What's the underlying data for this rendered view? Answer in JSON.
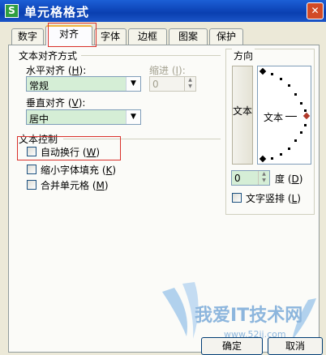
{
  "window": {
    "title": "单元格格式",
    "app_icon": "S"
  },
  "tabs": [
    {
      "label": "数字"
    },
    {
      "label": "对齐",
      "active": true
    },
    {
      "label": "字体"
    },
    {
      "label": "边框"
    },
    {
      "label": "图案"
    },
    {
      "label": "保护"
    }
  ],
  "alignment": {
    "section_title": "文本对齐方式",
    "horizontal_label": "水平对齐 (",
    "horizontal_key": "H",
    "horizontal_value": "常规",
    "indent_label": "缩进 (",
    "indent_key": "I",
    "indent_value": "0",
    "vertical_label": "垂直对齐 (",
    "vertical_key": "V",
    "vertical_value": "居中"
  },
  "text_control": {
    "section_title": "文本控制",
    "wrap_text": {
      "label": "自动换行 (",
      "key": "W",
      "checked": false
    },
    "shrink_to_fit": {
      "label": "缩小字体填充 (",
      "key": "K",
      "checked": false
    },
    "merge_cells": {
      "label": "合并单元格 (",
      "key": "M",
      "checked": false
    }
  },
  "orientation": {
    "section_title": "方向",
    "vertical_text_button": "文本",
    "dial_label": "文本",
    "degree_value": "0",
    "degree_label": "度 (",
    "degree_key": "D",
    "vertical_stack": {
      "label": "文字竖排 (",
      "key": "L",
      "checked": false
    }
  },
  "buttons": {
    "ok": "确定",
    "cancel": "取消"
  },
  "watermark": {
    "text": "我爱IT技术网",
    "url": "www.52ij.com"
  },
  "colors": {
    "highlight": "#d9302b",
    "combo_bg": "#d5eed6",
    "title_bar": "#0a3fb0"
  }
}
